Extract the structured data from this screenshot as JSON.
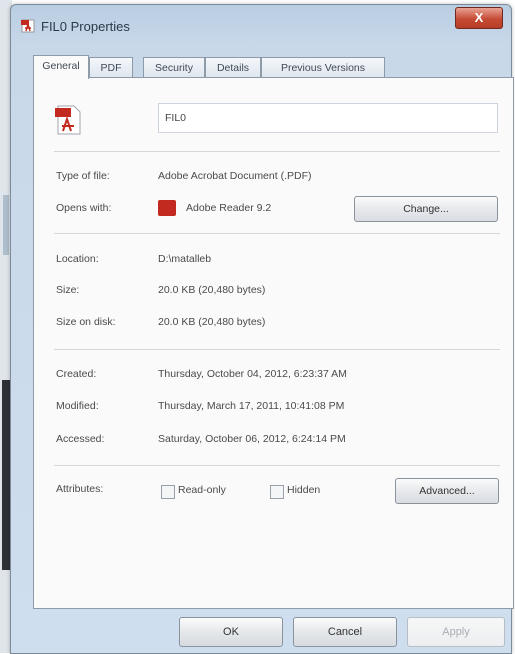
{
  "window": {
    "title": "FIL0 Properties",
    "close_label": "X"
  },
  "tabs": [
    {
      "label": "General"
    },
    {
      "label": "PDF"
    },
    {
      "label": "Security"
    },
    {
      "label": "Details"
    },
    {
      "label": "Previous Versions"
    }
  ],
  "general": {
    "file_name": "FIL0",
    "type_label": "Type of file:",
    "type_value": "Adobe Acrobat Document (.PDF)",
    "opens_label": "Opens with:",
    "opens_value": "Adobe Reader 9.2",
    "change_button": "Change...",
    "location_label": "Location:",
    "location_value": "D:\\matalleb",
    "size_label": "Size:",
    "size_value": "20.0 KB (20,480 bytes)",
    "size_disk_label": "Size on disk:",
    "size_disk_value": "20.0 KB (20,480 bytes)",
    "created_label": "Created:",
    "created_value": "Thursday, October 04, 2012, 6:23:37 AM",
    "modified_label": "Modified:",
    "modified_value": "Thursday, March 17, 2011, 10:41:08 PM",
    "accessed_label": "Accessed:",
    "accessed_value": "Saturday, October 06, 2012, 6:24:14 PM",
    "attributes_label": "Attributes:",
    "readonly_label": "Read-only",
    "hidden_label": "Hidden",
    "advanced_button": "Advanced..."
  },
  "footer": {
    "ok": "OK",
    "cancel": "Cancel",
    "apply": "Apply"
  },
  "colors": {
    "pdf_red": "#c22a1f",
    "close_red": "#c64b35"
  }
}
